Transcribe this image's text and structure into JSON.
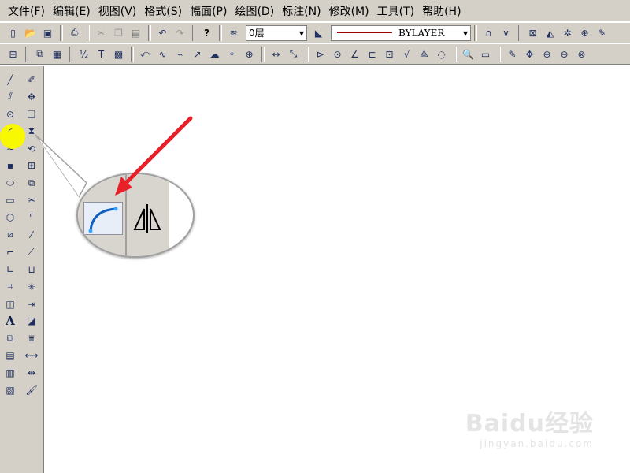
{
  "menubar": [
    "文件(F)",
    "编辑(E)",
    "视图(V)",
    "格式(S)",
    "幅面(P)",
    "绘图(D)",
    "标注(N)",
    "修改(M)",
    "工具(T)",
    "帮助(H)"
  ],
  "toolbar1": {
    "layer_value": "0层",
    "linetype_value": "BYLAYER",
    "help_glyph": "?",
    "combo_arrow": "▾"
  },
  "draw_toolbar": {
    "text_tool_glyph": "A"
  },
  "zoom_callout": {
    "highlighted_tool": "arc-tool"
  },
  "watermark": {
    "logo": "Baidu经验",
    "url": "jingyan.baidu.com"
  },
  "colors": {
    "chrome": "#d4d0c8",
    "highlight": "#f8f800",
    "arrow": "#e8202a"
  }
}
